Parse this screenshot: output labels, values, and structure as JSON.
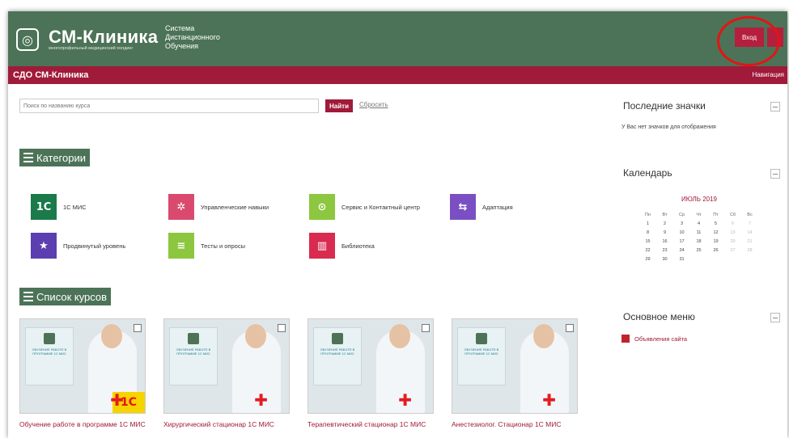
{
  "header": {
    "brand": "СМ-Клиника",
    "brand_sub": "многопрофильный медицинский холдинг",
    "system_line1": "Система",
    "system_line2": "Дистанционного",
    "system_line3": "Обучения",
    "login": "Вход",
    "logo_icon": "cm-logo-icon"
  },
  "navbar": {
    "site_name": "СДО СМ-Клиника",
    "navigation": "Навигация"
  },
  "search": {
    "placeholder": "Поиск по названию курса",
    "find": "Найти",
    "reset": "Сбросить"
  },
  "categories": {
    "title": "Категории",
    "items": [
      {
        "label": "1С МИС",
        "icon": "1c-icon",
        "glyph": "1С",
        "color": "#1a7a4a"
      },
      {
        "label": "Управленческие навыки",
        "icon": "people-icon",
        "glyph": "✲",
        "color": "#d94a6e"
      },
      {
        "label": "Сервис и Контактный центр",
        "icon": "location-hand-icon",
        "glyph": "⊙",
        "color": "#8dc63f"
      },
      {
        "label": "Адаптация",
        "icon": "handshake-icon",
        "glyph": "⇆",
        "color": "#7b4fc4"
      },
      {
        "label": "Продвинутый уровень",
        "icon": "stars-icon",
        "glyph": "★",
        "color": "#5b3fb0"
      },
      {
        "label": "Тесты и опросы",
        "icon": "checklist-icon",
        "glyph": "≡",
        "color": "#8dc63f"
      },
      {
        "label": "Библиотека",
        "icon": "book-icon",
        "glyph": "▥",
        "color": "#d92b4f"
      }
    ]
  },
  "courses": {
    "title": "Список курсов",
    "items": [
      {
        "title": "Обучение работе в программе 1С МИС",
        "panel": "ОБУЧЕНИЕ РАБОТЕ В ПРОГРАММЕ 1С МИС",
        "badge": "1С"
      },
      {
        "title": "Хирургический стационар 1С МИС",
        "panel": "ОБУЧЕНИЕ РАБОТЕ В ПРОГРАММЕ 1С МИС",
        "badge": ""
      },
      {
        "title": "Терапевтический стационар 1С МИС",
        "panel": "ОБУЧЕНИЕ РАБОТЕ В ПРОГРАММЕ 1С МИС",
        "badge": ""
      },
      {
        "title": "Анестезиолог. Стационар 1С МИС",
        "panel": "ОБУЧЕНИЕ РАБОТЕ В ПРОГРАММЕ 1С МИС",
        "badge": ""
      }
    ]
  },
  "sidebar": {
    "badges_title": "Последние значки",
    "badges_empty": "У Вас нет значков для отображения",
    "calendar_title": "Календарь",
    "calendar_month": "ИЮЛЬ 2019",
    "weekdays": [
      "Пн",
      "Вт",
      "Ср",
      "Чт",
      "Пт",
      "Сб",
      "Вс"
    ],
    "weeks": [
      [
        "1",
        "2",
        "3",
        "4",
        "5",
        "6",
        "7"
      ],
      [
        "8",
        "9",
        "10",
        "11",
        "12",
        "13",
        "14"
      ],
      [
        "15",
        "16",
        "17",
        "18",
        "19",
        "20",
        "21"
      ],
      [
        "22",
        "23",
        "24",
        "25",
        "26",
        "27",
        "28"
      ],
      [
        "29",
        "30",
        "31",
        "",
        "",
        "",
        ""
      ]
    ],
    "menu_title": "Основное меню",
    "announcements": "Объявления сайта"
  }
}
